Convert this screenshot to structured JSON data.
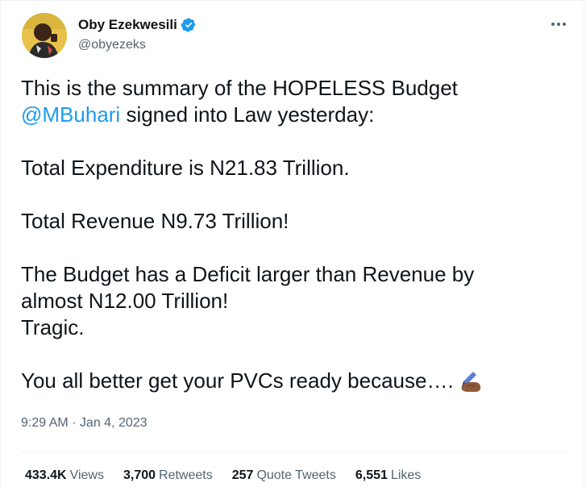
{
  "author": {
    "name": "Oby Ezekwesili",
    "handle": "@obyezeks",
    "verified": true
  },
  "tweet": {
    "line1": "This is the summary of the HOPELESS Budget",
    "mention": "@MBuhari",
    "line2_rest": " signed  into Law yesterday:",
    "expenditure": "Total Expenditure is N21.83 Trillion.",
    "revenue": "Total Revenue N9.73 Trillion!",
    "deficit_line1": "The Budget has a Deficit larger than Revenue by",
    "deficit_line2": "almost N12.00 Trillion!",
    "tragic": "Tragic.",
    "closing": "You all better get your PVCs ready because….",
    "emoji": "writing-hand-emoji"
  },
  "timestamp": "9:29 AM · Jan 4, 2023",
  "stats": {
    "views_count": "433.4K",
    "views_label": "Views",
    "retweets_count": "3,700",
    "retweets_label": "Retweets",
    "quotes_count": "257",
    "quotes_label": "Quote Tweets",
    "likes_count": "6,551",
    "likes_label": "Likes"
  },
  "more_icon": "more-horizontal-icon",
  "colors": {
    "link": "#1d9bf0",
    "text": "#0f1419",
    "muted": "#536471",
    "verified": "#1d9bf0"
  }
}
